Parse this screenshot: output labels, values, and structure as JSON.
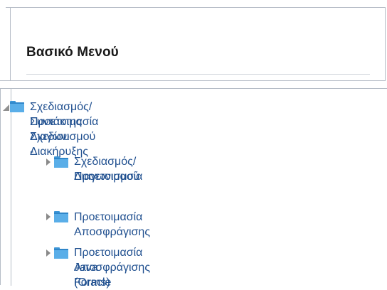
{
  "main_menu": {
    "title": "Βασικό Μενού"
  },
  "tree": {
    "root": {
      "label_line1": "Σχεδιασμός/Προετοιμασία Διαγωνισμού -",
      "label_line2": "Συντάκτης Σχεδίου Διακήρυξης",
      "expanded": true
    },
    "children": [
      {
        "label_line1": "Σχεδιασμός/Προετοιμασία",
        "label_line2": "Διαγωνισμού",
        "expanded": false
      },
      {
        "label_line1": "Προετοιμασία Αποσφράγισης",
        "label_line2": "",
        "expanded": false
      },
      {
        "label_line1": "Προετοιμασία Αποσφράγισης (Oracle",
        "label_line2": "Java Forms)",
        "expanded": false
      }
    ]
  },
  "icons": {
    "folder": "folder-icon",
    "expanded": "triangle-expanded-icon",
    "collapsed": "triangle-collapsed-icon"
  },
  "colors": {
    "link": "#1f4f8f",
    "folder": "#5aaee8",
    "border": "#b5bcc6"
  }
}
